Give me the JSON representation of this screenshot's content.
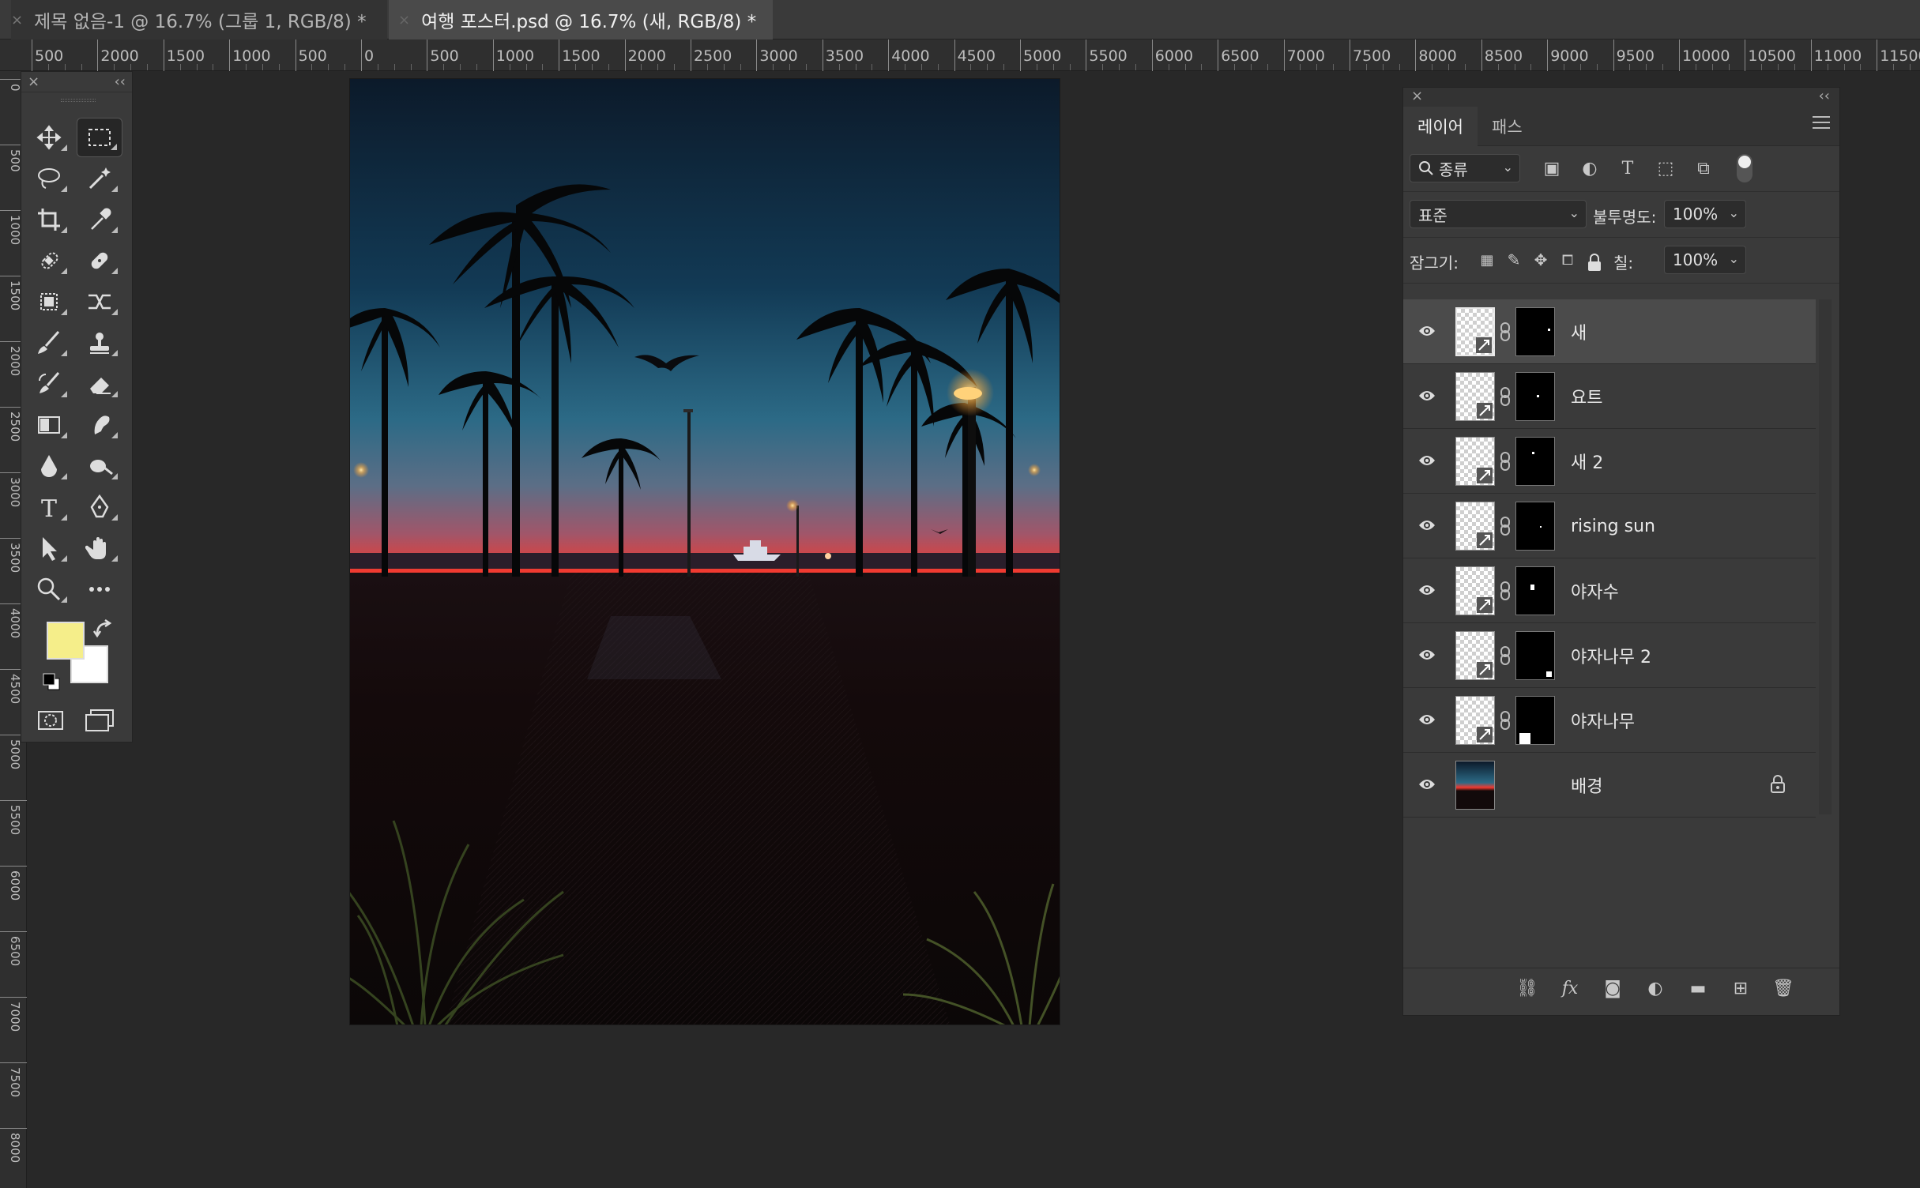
{
  "tabs": [
    {
      "close": "×",
      "label": "제목 없음-1 @ 16.7% (그룹 1, RGB/8) *"
    },
    {
      "close": "×",
      "label": "여행 포스터.psd @ 16.7% (새, RGB/8) *"
    }
  ],
  "ruler": {
    "h_labels": [
      "500",
      "2000",
      "1500",
      "1000",
      "500",
      "0",
      "500",
      "1000",
      "1500",
      "2000",
      "2500",
      "3000",
      "3500",
      "4000",
      "4500",
      "5000",
      "5500",
      "6000",
      "6500",
      "7000",
      "7500",
      "8000",
      "8500",
      "9000",
      "9500",
      "10000",
      "10500",
      "11000",
      "11500"
    ],
    "v_labels": [
      "0",
      "500",
      "1000",
      "1500",
      "2000",
      "2500",
      "3000",
      "3500",
      "4000",
      "4500",
      "5000",
      "5500",
      "6000",
      "6500",
      "7000",
      "7500",
      "8000"
    ]
  },
  "toolbar": {
    "close": "×",
    "collapse": "‹‹",
    "tools": [
      {
        "name": "move-tool",
        "selected": false
      },
      {
        "name": "rectangular-marquee-tool",
        "selected": true
      },
      {
        "name": "lasso-tool",
        "selected": false
      },
      {
        "name": "magic-wand-tool",
        "selected": false
      },
      {
        "name": "crop-tool",
        "selected": false
      },
      {
        "name": "eyedropper-tool",
        "selected": false
      },
      {
        "name": "spot-healing-tool",
        "selected": false
      },
      {
        "name": "healing-brush-tool",
        "selected": false
      },
      {
        "name": "content-aware-move-tool",
        "selected": false
      },
      {
        "name": "red-eye-tool",
        "selected": false
      },
      {
        "name": "brush-tool",
        "selected": false
      },
      {
        "name": "clone-stamp-tool",
        "selected": false
      },
      {
        "name": "history-brush-tool",
        "selected": false
      },
      {
        "name": "eraser-tool",
        "selected": false
      },
      {
        "name": "gradient-tool",
        "selected": false
      },
      {
        "name": "smudge-tool",
        "selected": false
      },
      {
        "name": "blur-tool",
        "selected": false
      },
      {
        "name": "dodge-tool",
        "selected": false
      },
      {
        "name": "type-tool",
        "selected": false
      },
      {
        "name": "pen-tool",
        "selected": false
      },
      {
        "name": "path-selection-tool",
        "selected": false
      },
      {
        "name": "hand-tool",
        "selected": false
      },
      {
        "name": "zoom-tool",
        "selected": false
      },
      {
        "name": "more-tools",
        "selected": false
      }
    ],
    "foreground_color": "#f5ee8a",
    "background_color": "#ffffff"
  },
  "layers_panel": {
    "close": "×",
    "collapse": "‹‹",
    "tab_layers": "레이어",
    "tab_paths": "패스",
    "filter_label": "종류",
    "blend_mode": "표준",
    "opacity_label": "불투명도:",
    "opacity_value": "100%",
    "lock_label": "잠그기:",
    "fill_label": "칠:",
    "fill_value": "100%",
    "layers": [
      {
        "name": "새",
        "active": true,
        "has_mask": true,
        "locked": false
      },
      {
        "name": "요트",
        "active": false,
        "has_mask": true,
        "locked": false
      },
      {
        "name": "새 2",
        "active": false,
        "has_mask": true,
        "locked": false
      },
      {
        "name": "rising sun",
        "active": false,
        "has_mask": true,
        "locked": false
      },
      {
        "name": "야자수",
        "active": false,
        "has_mask": true,
        "locked": false
      },
      {
        "name": "야자나무 2",
        "active": false,
        "has_mask": true,
        "locked": false
      },
      {
        "name": "야자나무",
        "active": false,
        "has_mask": true,
        "locked": false
      },
      {
        "name": "배경",
        "active": false,
        "has_mask": false,
        "locked": true
      }
    ],
    "footer_fx": "fx"
  },
  "colors": {
    "ui_bg": "#282828",
    "panel_bg": "#3a3a3a",
    "sky_top": "#0c1b2c",
    "horizon": "#ff3a2a"
  }
}
